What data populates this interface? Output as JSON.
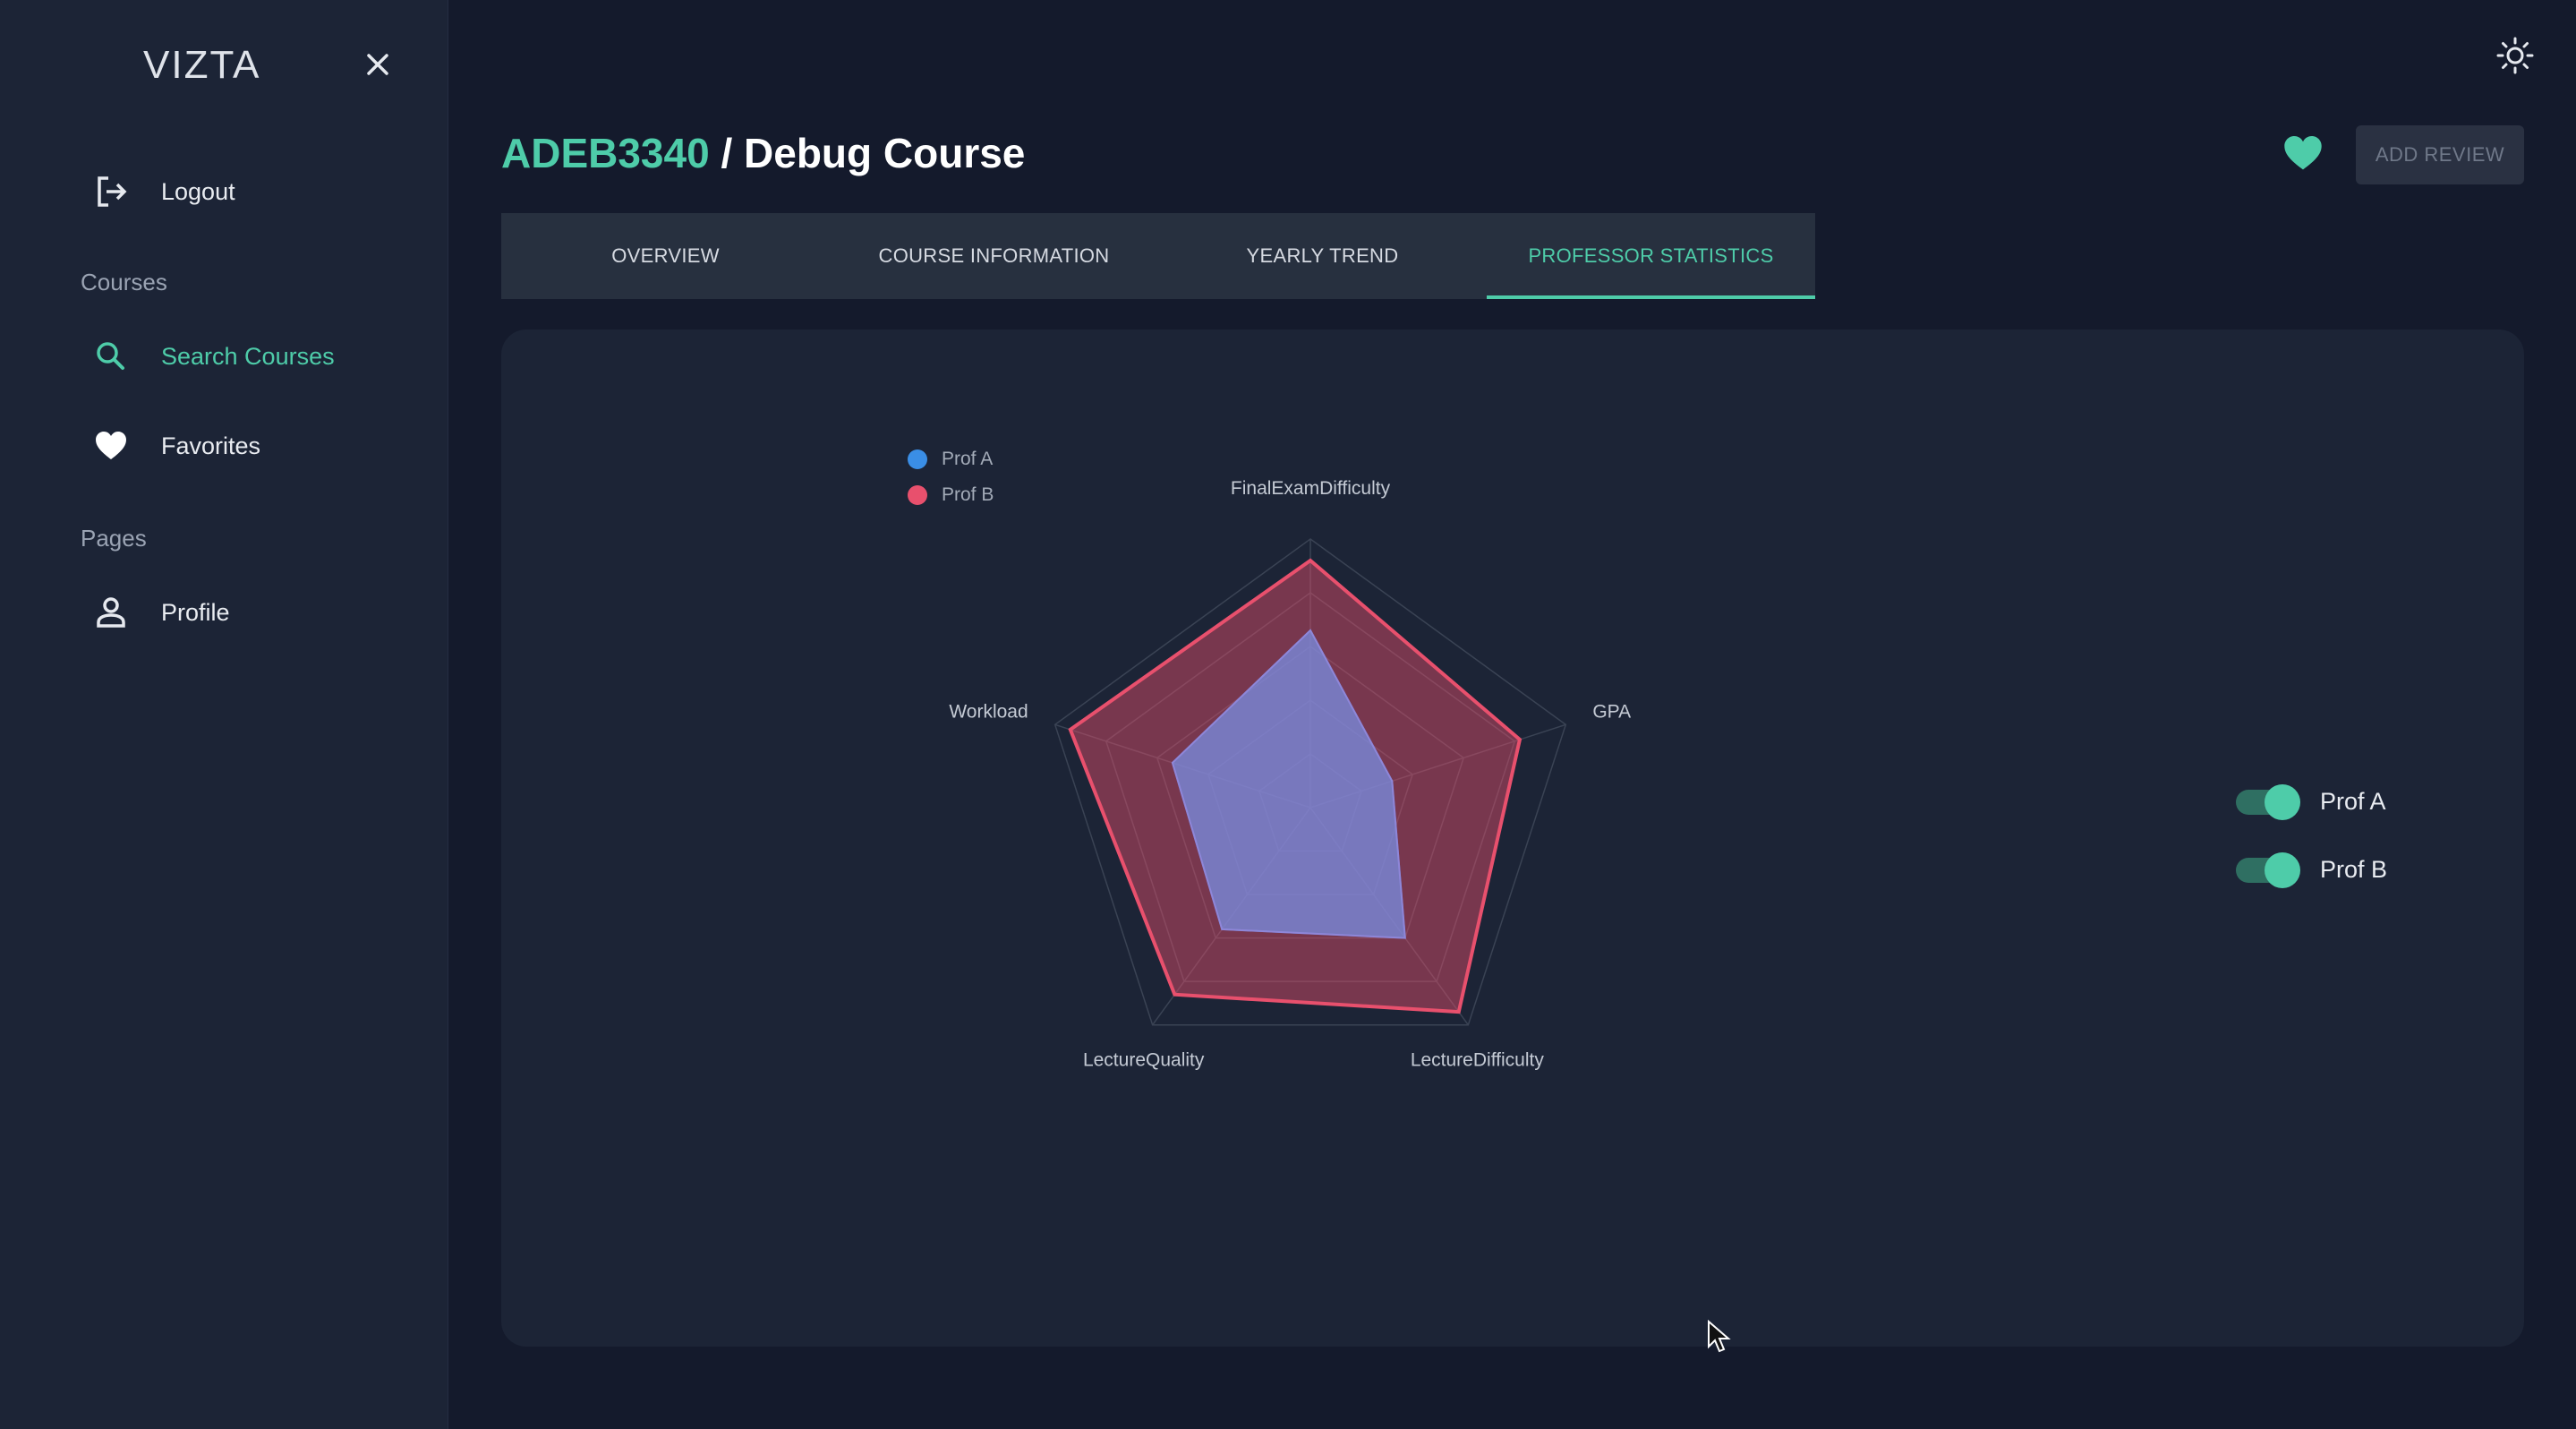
{
  "app": {
    "brand": "VIZTA"
  },
  "sidebar": {
    "logout_label": "Logout",
    "courses_section": "Courses",
    "search_courses_label": "Search Courses",
    "favorites_label": "Favorites",
    "pages_section": "Pages",
    "profile_label": "Profile"
  },
  "header": {
    "course_code": "ADEB3340",
    "separator": "/",
    "course_name": "Debug Course",
    "add_review_label": "ADD REVIEW"
  },
  "tabs": [
    {
      "label": "OVERVIEW",
      "active": false
    },
    {
      "label": "COURSE INFORMATION",
      "active": false
    },
    {
      "label": "YEARLY TREND",
      "active": false
    },
    {
      "label": "PROFESSOR STATISTICS",
      "active": true
    }
  ],
  "toggles": [
    {
      "label": "Prof A",
      "on": true
    },
    {
      "label": "Prof B",
      "on": true
    }
  ],
  "colors": {
    "accent": "#4ecca9",
    "prof_a": "#3a8ee6",
    "prof_b": "#e8506d"
  },
  "chart_data": {
    "type": "radar",
    "axes": [
      "FinalExamDifficulty",
      "GPA",
      "LectureDifficulty",
      "LectureQuality",
      "Workload"
    ],
    "range": [
      0,
      5
    ],
    "series": [
      {
        "name": "Prof A",
        "values": [
          3.3,
          1.6,
          3.0,
          2.8,
          2.7
        ]
      },
      {
        "name": "Prof B",
        "values": [
          4.6,
          4.1,
          4.7,
          4.3,
          4.7
        ]
      }
    ],
    "legend_position": "top-left",
    "grid": true
  }
}
